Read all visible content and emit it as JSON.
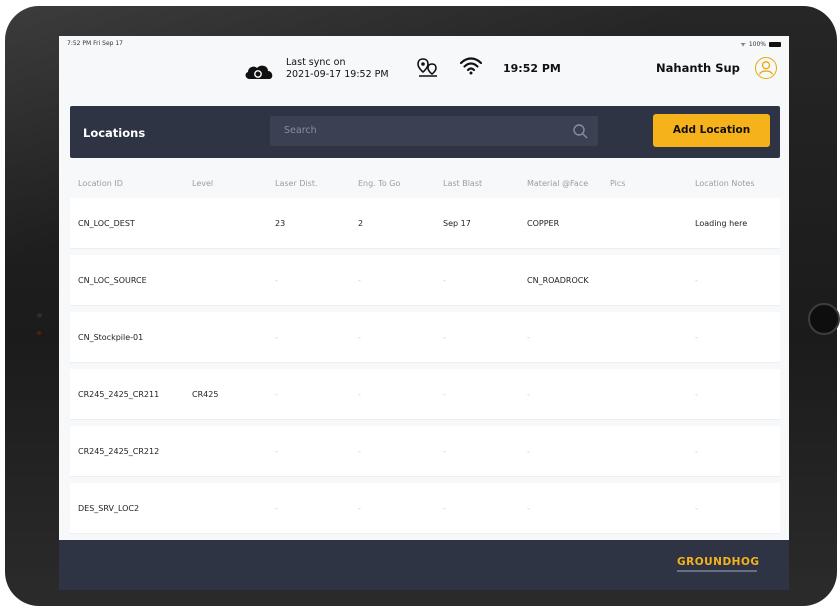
{
  "status_bar": {
    "time": "7:52 PM  Fri Sep 17",
    "battery": "100%"
  },
  "header": {
    "sync_line1": "Last sync on",
    "sync_line2": "2021-09-17 19:52 PM",
    "clock": "19:52 PM",
    "user_name": "Nahanth Sup"
  },
  "toolbar": {
    "title": "Locations",
    "search_placeholder": "Search",
    "add_label": "Add Location"
  },
  "table": {
    "columns": [
      "Location ID",
      "Level",
      "Laser Dist.",
      "Eng. To Go",
      "Last Blast",
      "Material @Face",
      "Pics",
      "Location Notes"
    ],
    "rows": [
      [
        "CN_LOC_DEST",
        "",
        "23",
        "2",
        "Sep 17",
        "COPPER",
        "",
        "Loading here"
      ],
      [
        "CN_LOC_SOURCE",
        "",
        "-",
        "-",
        "-",
        "CN_ROADROCK",
        "",
        "-"
      ],
      [
        "CN_Stockpile-01",
        "",
        "-",
        "-",
        "-",
        "-",
        "",
        "-"
      ],
      [
        "CR245_2425_CR211",
        "CR425",
        "-",
        "-",
        "-",
        "-",
        "",
        "-"
      ],
      [
        "CR245_2425_CR212",
        "",
        "-",
        "-",
        "-",
        "-",
        "",
        "-"
      ],
      [
        "DES_SRV_LOC2",
        "",
        "-",
        "-",
        "-",
        "-",
        "",
        "-"
      ]
    ]
  },
  "footer": {
    "logo": "GROUNDHOG"
  },
  "colors": {
    "navy": "#2f3445",
    "accent": "#f6b21a"
  }
}
